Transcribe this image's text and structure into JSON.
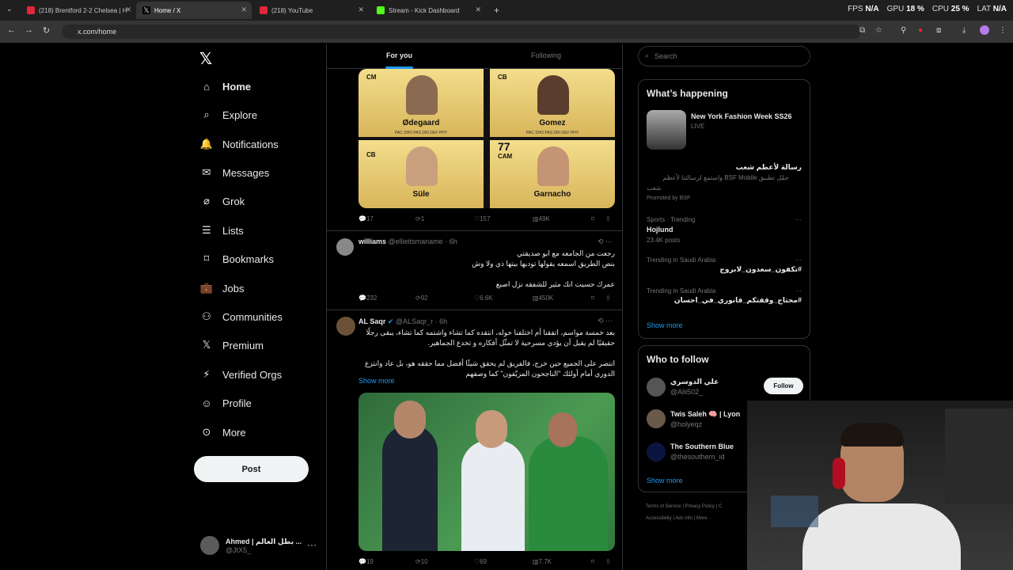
{
  "browser": {
    "tabs": [
      {
        "title": "(218) Brentford 2-2 Chelsea | H",
        "active": false,
        "icon": "youtube-icon"
      },
      {
        "title": "Home / X",
        "active": true,
        "icon": "x-icon"
      },
      {
        "title": "(218) YouTube",
        "active": false,
        "icon": "youtube-icon"
      },
      {
        "title": "Stream - Kick Dashboard",
        "active": false,
        "icon": "kick-icon"
      }
    ],
    "url": "x.com/home",
    "stats": {
      "fps_label": "FPS",
      "fps": "N/A",
      "gpu_label": "GPU",
      "gpu": "18 %",
      "cpu_label": "CPU",
      "cpu": "25 %",
      "lat_label": "LAT",
      "lat": "N/A"
    }
  },
  "sidebar": {
    "items": [
      {
        "label": "Home",
        "icon": "home-icon"
      },
      {
        "label": "Explore",
        "icon": "search-icon"
      },
      {
        "label": "Notifications",
        "icon": "bell-icon"
      },
      {
        "label": "Messages",
        "icon": "mail-icon"
      },
      {
        "label": "Grok",
        "icon": "grok-icon"
      },
      {
        "label": "Lists",
        "icon": "list-icon"
      },
      {
        "label": "Bookmarks",
        "icon": "bookmark-icon"
      },
      {
        "label": "Jobs",
        "icon": "briefcase-icon"
      },
      {
        "label": "Communities",
        "icon": "people-icon"
      },
      {
        "label": "Premium",
        "icon": "x-icon"
      },
      {
        "label": "Verified Orgs",
        "icon": "lightning-icon"
      },
      {
        "label": "Profile",
        "icon": "person-icon"
      },
      {
        "label": "More",
        "icon": "more-circle-icon"
      }
    ],
    "post_label": "Post",
    "account": {
      "name": "Ahmed | بطل العالم ...",
      "handle": "@JtX5_"
    }
  },
  "feed": {
    "tabs": {
      "for_you": "For you",
      "following": "Following"
    },
    "cards": [
      {
        "name": "Ødegaard",
        "pos": "CM",
        "num": ""
      },
      {
        "name": "Gomez",
        "pos": "CB",
        "num": ""
      },
      {
        "name": "Süle",
        "pos": "CB",
        "num": ""
      },
      {
        "name": "Garnacho",
        "pos": "CAM",
        "num": "77"
      }
    ],
    "card_stats": "PAC SHO PAS DRI DEF PHY",
    "tweet0_actions": {
      "replies": "17",
      "retweets": "1",
      "likes": "157",
      "views": "49K"
    },
    "tweet1": {
      "name": "williams",
      "handle": "@ellieitsmaname",
      "time": "· 6h",
      "lines": [
        "رجعت من الجامعه مع ابو صديقتي",
        "بنص الطريق اسمعه يقولها توديها بيتها ذي ولا وش",
        "",
        "عمرك حسيت انك مثير للشفقه نزل اصبع"
      ],
      "replies": "232",
      "retweets": "92",
      "likes": "6.6K",
      "views": "450K"
    },
    "tweet2": {
      "name": "AL Saqr",
      "handle": "@ALSaqr_r",
      "time": "· 6h",
      "lines": [
        "بعد خمسة مواسم، اتفقنا أم اختلفنا حوله، انتقده كما تشاء واشتمه كما تشاء، يبقى رجلًا",
        "حقيقيًا لم يقبل أن يؤدي مسرحية لا تمثّل أفكاره و تخدع الجماهير.",
        "",
        "انتصر على الجميع حين خرج، فالفريق لم يحقق شيئًا أفضل مما حققه هو، بل عاد وانتزع",
        "الدوري أمام أولئك \"الناجحون المزيّفون\" كما وصفهم"
      ],
      "show_more": "Show more",
      "replies": "19",
      "retweets": "10",
      "likes": "69",
      "views": "7.7K"
    }
  },
  "right": {
    "search_placeholder": "Search",
    "happening": {
      "title": "What’s happening",
      "event": {
        "title": "New York Fashion Week SS26",
        "status": "LIVE"
      },
      "promo": {
        "title": "رسالة لأعظم شعب",
        "text1": "حمّل تطبيق BSF Mobile واستمع لرسالتنا لأعظم",
        "text2": "شعب",
        "promoted": "Promoted by BSF"
      },
      "trends": [
        {
          "context": "Sports · Trending",
          "name": "Hojlund",
          "posts": "23.4K posts"
        },
        {
          "context": "Trending in Saudi Arabia",
          "name": "#تكفون_سعدون_لابروج",
          "posts": ""
        },
        {
          "context": "Trending in Saudi Arabia",
          "name": "#محتاج_وقفتكم_فانوري_في_احسان",
          "posts": ""
        }
      ],
      "show_more": "Show more"
    },
    "who_to_follow": {
      "title": "Who to follow",
      "accounts": [
        {
          "name": "علي الدوسري",
          "handle": "@Alii502_"
        },
        {
          "name": "Twis Saleh 🧠 | Lyon",
          "handle": "@holyeqz"
        },
        {
          "name": "The Southern Blue",
          "handle": "@thesouthern_id"
        }
      ],
      "follow_label": "Follow",
      "show_more": "Show more"
    },
    "footer": {
      "line1": [
        "Terms of Service",
        "Privacy Policy",
        "C"
      ],
      "line2": [
        "Accessibility",
        "Ads info",
        "More ···"
      ]
    }
  },
  "colors": {
    "accent": "#1d9bf0",
    "bg": "#000000",
    "border": "#2f3336",
    "muted": "#71767b"
  }
}
